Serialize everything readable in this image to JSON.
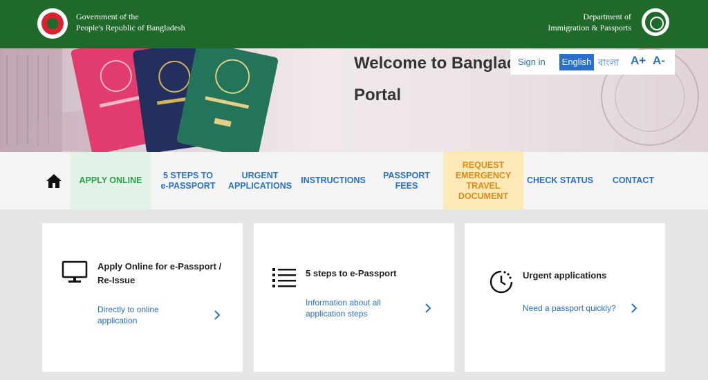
{
  "header": {
    "gov_line1": "Government of the",
    "gov_line2": "People's Republic of Bangladesh",
    "dept_line1": "Department of",
    "dept_line2": "Immigration & Passports"
  },
  "hero": {
    "welcome": "Welcome to Bangladesh e-Passport",
    "portal": "Portal"
  },
  "lang": {
    "signin": "Sign in",
    "english": "English",
    "bangla": "বাংলা",
    "a_plus": "A+",
    "a_minus": "A-"
  },
  "nav": {
    "home_icon": "home-icon",
    "apply_online": "APPLY ONLINE",
    "steps_1": "5 STEPS TO",
    "steps_2": "e-PASSPORT",
    "urgent_1": "URGENT",
    "urgent_2": "APPLICATIONS",
    "instructions": "INSTRUCTIONS",
    "fees_1": "PASSPORT",
    "fees_2": "FEES",
    "emerg_1": "REQUEST",
    "emerg_2": "EMERGENCY",
    "emerg_3": "TRAVEL",
    "emerg_4": "DOCUMENT",
    "check_status": "CHECK STATUS",
    "contact": "CONTACT"
  },
  "cards": [
    {
      "title_1": "Apply Online for e-Passport /",
      "title_2": "Re-Issue",
      "link_1": "Directly to online",
      "link_2": "application",
      "icon": "monitor-icon"
    },
    {
      "title": "5 steps to e-Passport",
      "link_1": "Information about all",
      "link_2": "application steps",
      "icon": "list-icon"
    },
    {
      "title": "Urgent applications",
      "link": "Need a passport quickly?",
      "icon": "clock-icon"
    }
  ],
  "colors": {
    "header_green": "#1f6a2a",
    "link_blue": "#2a6fc8",
    "apply_green": "#2f9e4b",
    "emergency_orange": "#e08a17"
  }
}
